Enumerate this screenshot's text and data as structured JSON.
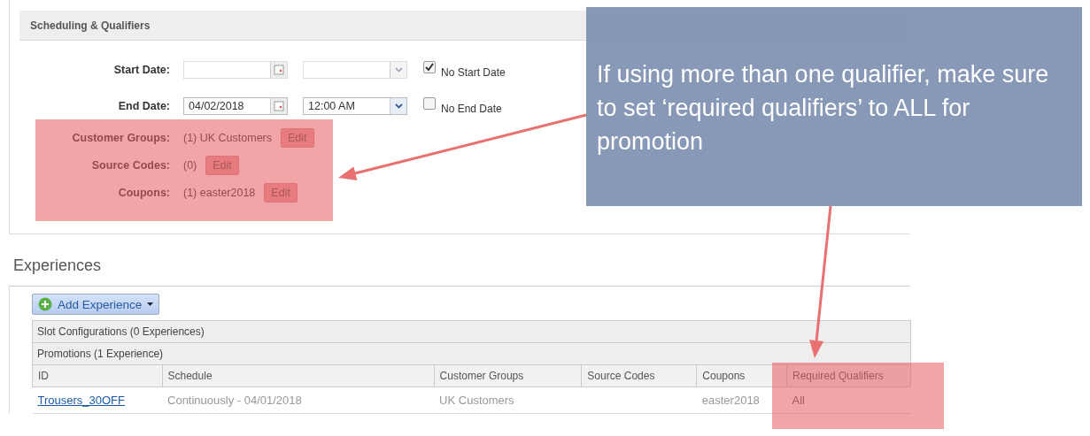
{
  "scheduling": {
    "title": "Scheduling & Qualifiers",
    "start_date": {
      "label": "Start Date:",
      "no_date": {
        "label": "No Start Date",
        "checked": true
      }
    },
    "end_date": {
      "label": "End Date:",
      "date": "04/02/2018",
      "time": "12:00 AM",
      "no_date": {
        "label": "No End Date",
        "checked": false
      }
    },
    "qualifiers": [
      {
        "label": "Customer Groups:",
        "value": "(1) UK Customers",
        "button": "Edit"
      },
      {
        "label": "Source Codes:",
        "value": "(0)",
        "button": "Edit"
      },
      {
        "label": "Coupons:",
        "value": "(1) easter2018",
        "button": "Edit"
      }
    ]
  },
  "experiences": {
    "title": "Experiences",
    "add_button": "Add Experience",
    "groups": [
      "Slot Configurations (0 Experiences)",
      "Promotions (1 Experience)"
    ],
    "table": {
      "columns": [
        "ID",
        "Schedule",
        "Customer Groups",
        "Source Codes",
        "Coupons",
        "Required Qualifiers"
      ],
      "rows": [
        {
          "cells": [
            "Trousers_30OFF",
            "Continuously - 04/01/2018",
            "UK Customers",
            "",
            "easter2018",
            "All"
          ]
        }
      ]
    }
  },
  "callout": {
    "text": "If using more than one qualifier, make sure to set ‘required qualifiers’ to ALL for promotion"
  }
}
